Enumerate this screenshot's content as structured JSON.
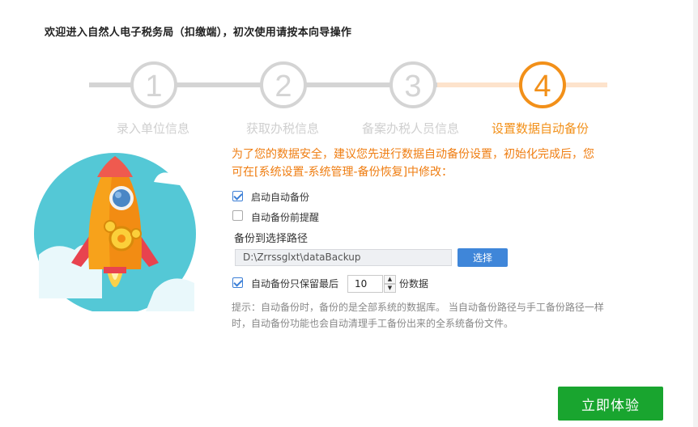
{
  "header": {
    "title": "欢迎进入自然人电子税务局（扣缴端），初次使用请按本向导操作"
  },
  "steps": [
    {
      "number": "1",
      "label": "录入单位信息",
      "state": "done"
    },
    {
      "number": "2",
      "label": "获取办税信息",
      "state": "done"
    },
    {
      "number": "3",
      "label": "备案办税人员信息",
      "state": "done"
    },
    {
      "number": "4",
      "label": "设置数据自动备份",
      "state": "active"
    }
  ],
  "colors": {
    "accent": "#f29019",
    "inactive": "#d4d4d4",
    "primary_button": "#19a52f",
    "select_button": "#3f86d9"
  },
  "intro_text": "为了您的数据安全，建议您先进行数据自动备份设置，初始化完成后，您可在[系统设置-系统管理-备份恢复]中修改：",
  "options": {
    "auto_backup": {
      "label": "启动自动备份",
      "checked": true
    },
    "remind_before": {
      "label": "自动备份前提醒",
      "checked": false
    },
    "path_label": "备份到选择路径",
    "path_value": "D:\\Zrrssglxt\\dataBackup",
    "select_button": "选择",
    "keep_latest": {
      "label": "自动备份只保留最后",
      "checked": true,
      "count": "10",
      "suffix": "份数据"
    }
  },
  "hint": "提示：自动备份时，备份的是全部系统的数据库。 当自动备份路径与手工备份路径一样时，自动备份功能也会自动清理手工备份出来的全系统备份文件。",
  "footer": {
    "start_button": "立即体验"
  },
  "icons": {
    "spinner_up": "triangle-up-icon",
    "spinner_down": "triangle-down-icon",
    "illustration": "rocket-illustration"
  }
}
